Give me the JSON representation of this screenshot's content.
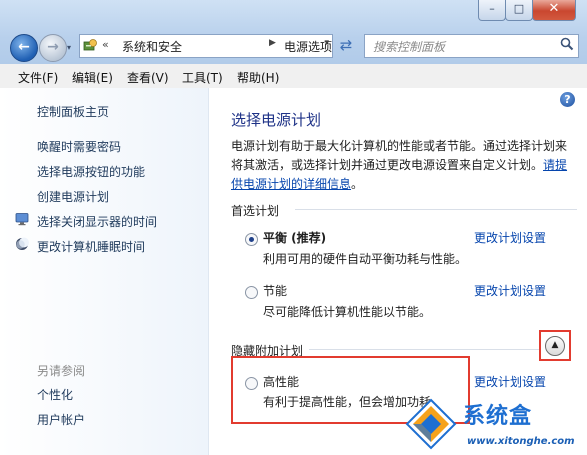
{
  "window": {
    "min_label": "–",
    "max_label": "□",
    "close_label": "✕"
  },
  "nav": {
    "back_label": "←",
    "forward_label": "→",
    "history_label": "▾"
  },
  "address": {
    "prefix": "«",
    "crumb1": "系统和安全",
    "arrow": "▶",
    "crumb2": "电源选项",
    "dropdown": "▾",
    "refresh": "⇄"
  },
  "search": {
    "placeholder": "搜索控制面板"
  },
  "menu": [
    "文件(F)",
    "编辑(E)",
    "查看(V)",
    "工具(T)",
    "帮助(H)"
  ],
  "sidebar": {
    "home": "控制面板主页",
    "links": [
      "唤醒时需要密码",
      "选择电源按钮的功能",
      "创建电源计划",
      "选择关闭显示器的时间",
      "更改计算机睡眠时间"
    ],
    "see_also": "另请参阅",
    "see_also_links": [
      "个性化",
      "用户帐户"
    ]
  },
  "main": {
    "help": "?",
    "title": "选择电源计划",
    "desc_text": "电源计划有助于最大化计算机的性能或者节能。通过选择计划来将其激活，或选择计划并通过更改电源设置来自定义计划。",
    "desc_link": "请提供电源计划的详细信息",
    "desc_end": "。",
    "preferred_head": "首选计划",
    "hidden_head": "隐藏附加计划",
    "collapse": "▲",
    "change_link": "更改计划设置",
    "plans": [
      {
        "name": "平衡 (推荐)",
        "desc": "利用可用的硬件自动平衡功耗与性能。",
        "selected": true
      },
      {
        "name": "节能",
        "desc": "尽可能降低计算机性能以节能。",
        "selected": false
      },
      {
        "name": "高性能",
        "desc": "有利于提高性能，但会增加功耗。",
        "selected": false
      }
    ]
  },
  "watermark": {
    "text": "系统盒",
    "url": "www.xitonghe.com"
  },
  "colors": {
    "link": "#0645ad",
    "title": "#1e3287",
    "highlight": "#e23b2f"
  }
}
